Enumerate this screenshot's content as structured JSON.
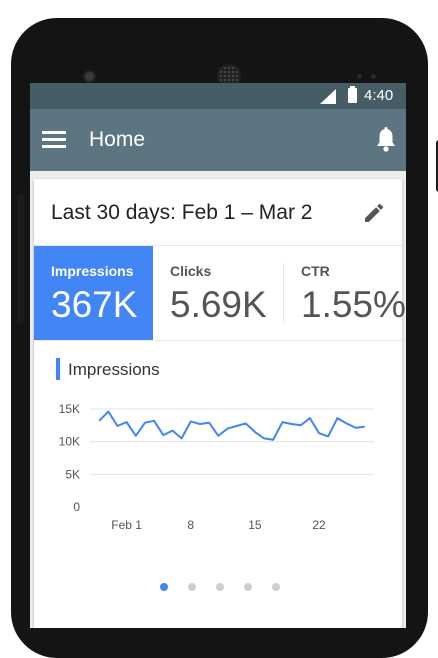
{
  "status_bar": {
    "time": "4:40"
  },
  "app_bar": {
    "title": "Home"
  },
  "card": {
    "date_range": "Last 30 days: Feb 1 – Mar 2",
    "metrics": [
      {
        "label": "Impressions",
        "value": "367K",
        "active": true
      },
      {
        "label": "Clicks",
        "value": "5.69K",
        "active": false
      },
      {
        "label": "CTR",
        "value": "1.55%",
        "active": false
      }
    ]
  },
  "chart_data": {
    "type": "line",
    "title": "Impressions",
    "y_ticks": [
      "0",
      "5K",
      "10K",
      "15K"
    ],
    "ylim": [
      0,
      15000
    ],
    "x_ticks": [
      {
        "day": 4,
        "label": "Feb 1"
      },
      {
        "day": 11,
        "label": "8"
      },
      {
        "day": 18,
        "label": "15"
      },
      {
        "day": 25,
        "label": "22"
      }
    ],
    "xlim": [
      0,
      31
    ],
    "grid": true,
    "series": [
      {
        "color": "#4285f4",
        "values": [
          13200,
          14600,
          12400,
          13000,
          10900,
          12900,
          13200,
          11000,
          11700,
          10500,
          13100,
          12700,
          12900,
          10900,
          12000,
          12400,
          12800,
          11500,
          10500,
          10300,
          13000,
          12700,
          12500,
          13600,
          11300,
          10800,
          13600,
          12800,
          12100,
          12300
        ]
      }
    ]
  },
  "pagination": {
    "count": 5,
    "active": 0
  }
}
